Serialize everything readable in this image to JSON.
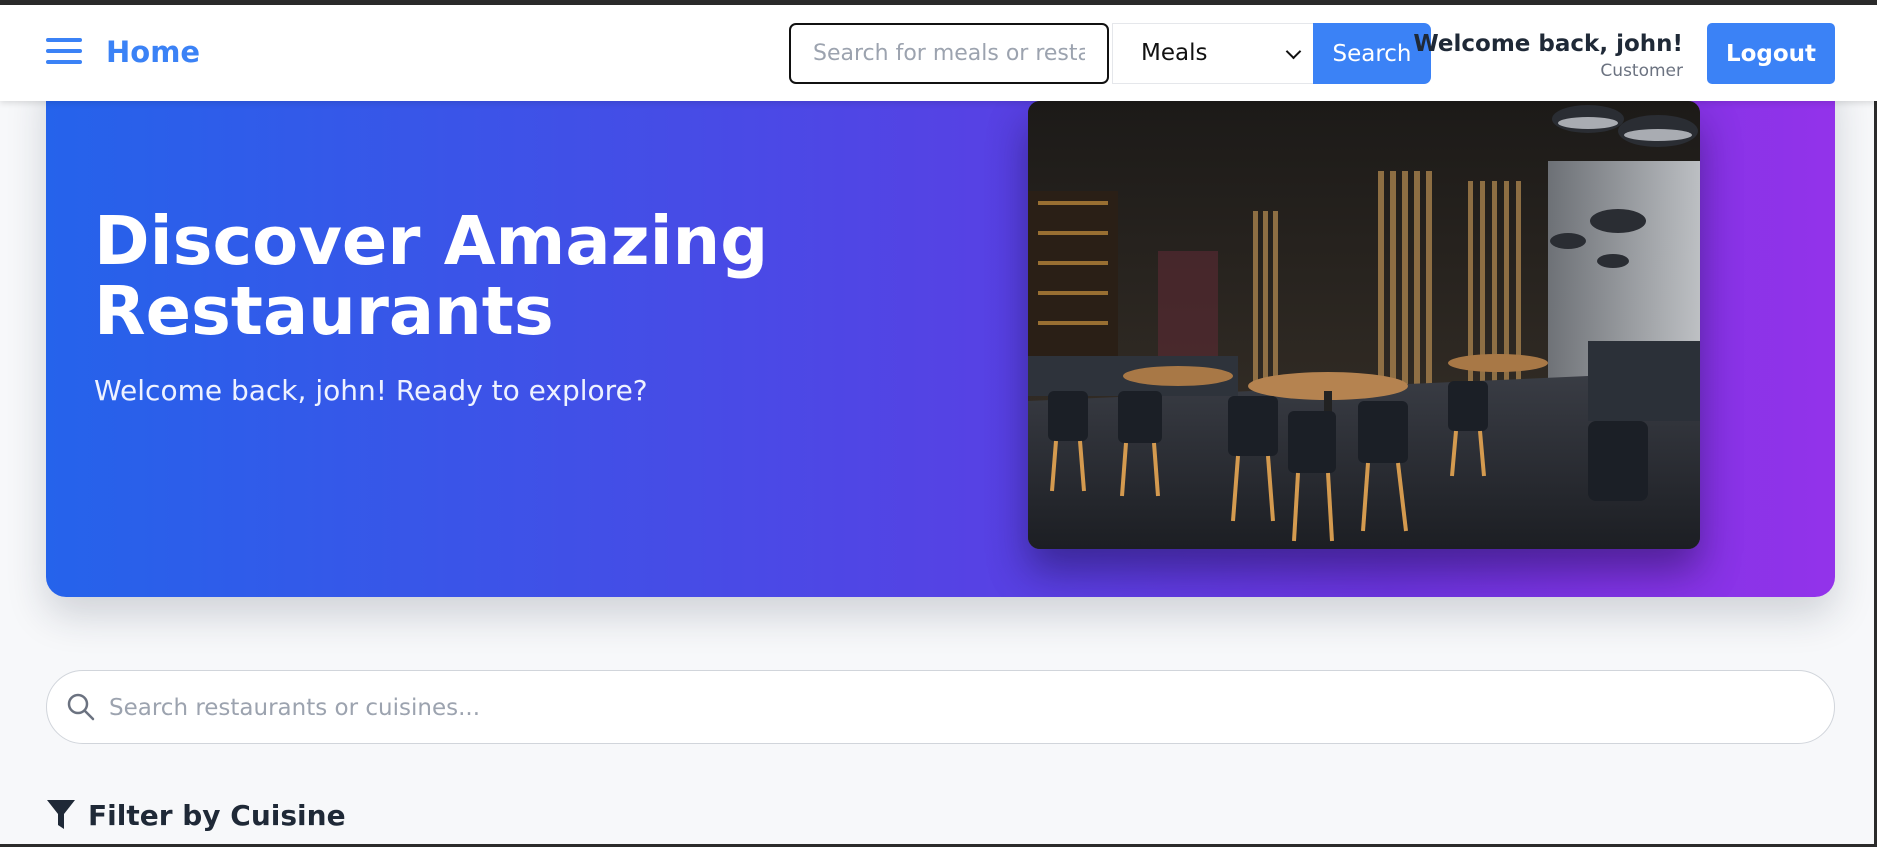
{
  "nav": {
    "home_label": "Home",
    "search_placeholder": "Search for meals or restaurants",
    "search_type_selected": "Meals",
    "search_button_label": "Search",
    "welcome_text": "Welcome back, john!",
    "user_role": "Customer",
    "logout_label": "Logout"
  },
  "hero": {
    "title": "Discover Amazing Restaurants",
    "subtitle": "Welcome back, john! Ready to explore?",
    "image_icon": "restaurant-interior-photo"
  },
  "restaurant_search": {
    "placeholder": "Search restaurants or cuisines...",
    "icon": "search-icon"
  },
  "filter": {
    "heading": "Filter by Cuisine",
    "icon": "funnel-icon"
  },
  "colors": {
    "accent": "#3b82f6",
    "hero_gradient_start": "#2563eb",
    "hero_gradient_end": "#9333ea"
  }
}
